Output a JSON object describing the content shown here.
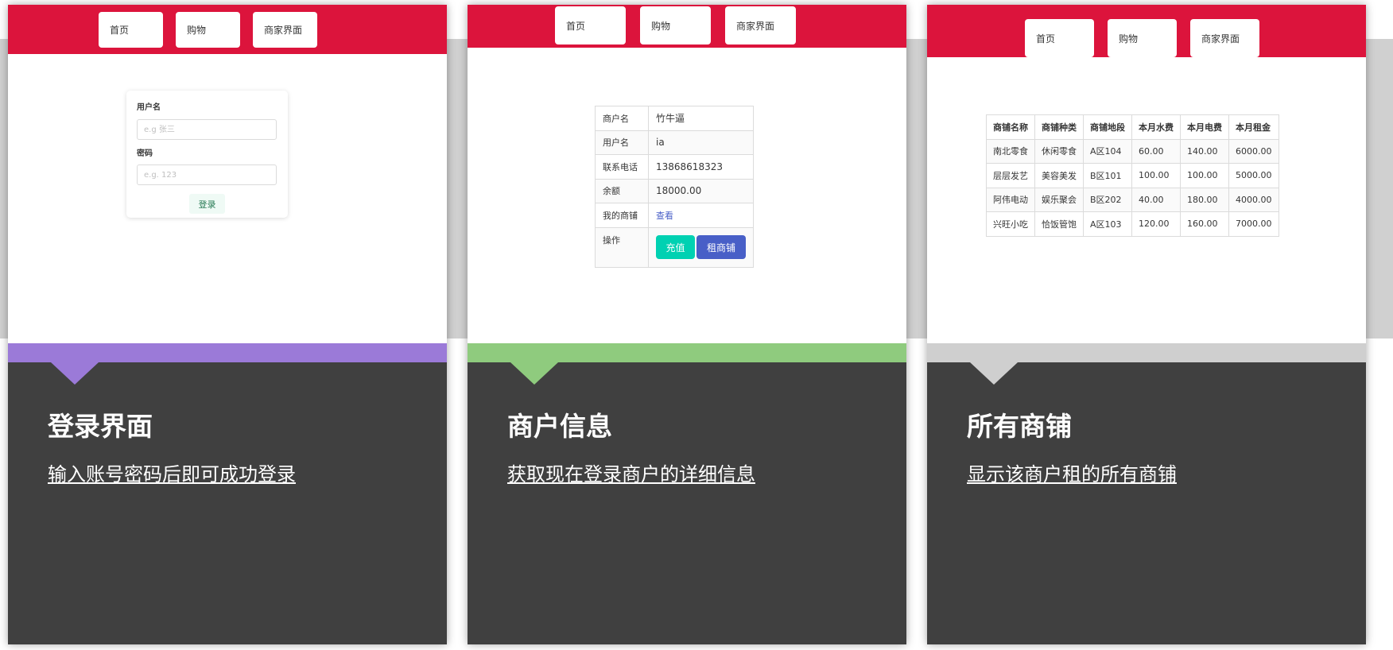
{
  "nav": {
    "home": "首页",
    "shop": "购物",
    "merchant": "商家界面"
  },
  "cards": [
    {
      "title": "登录界面",
      "desc": "输入账号密码后即可成功登录",
      "accent": "#9b7ad8"
    },
    {
      "title": "商户信息",
      "desc": "获取现在登录商户的详细信息",
      "accent": "#8fcb7e"
    },
    {
      "title": "所有商铺",
      "desc": "显示该商户租的所有商铺",
      "accent": "#cfcfcf"
    }
  ],
  "login": {
    "username_label": "用户名",
    "username_placeholder": "e.g 张三",
    "password_label": "密码",
    "password_placeholder": "e.g. 123",
    "submit": "登录"
  },
  "info": {
    "rows": [
      {
        "key": "商户名",
        "value": "竹牛逼"
      },
      {
        "key": "用户名",
        "value": "ia"
      },
      {
        "key": "联系电话",
        "value": "13868618323"
      },
      {
        "key": "余额",
        "value": "18000.00"
      },
      {
        "key": "我的商铺",
        "value": "查看"
      }
    ],
    "ops_label": "操作",
    "recharge": "充值",
    "rent": "租商铺"
  },
  "shops": {
    "headers": [
      "商铺名称",
      "商铺种类",
      "商铺地段",
      "本月水费",
      "本月电费",
      "本月租金"
    ],
    "rows": [
      [
        "南北零食",
        "休闲零食",
        "A区104",
        "60.00",
        "140.00",
        "6000.00"
      ],
      [
        "层层发艺",
        "美容美发",
        "B区101",
        "100.00",
        "100.00",
        "5000.00"
      ],
      [
        "阿伟电动",
        "娱乐聚会",
        "B区202",
        "40.00",
        "180.00",
        "4000.00"
      ],
      [
        "兴旺小吃",
        "恰饭管饱",
        "A区103",
        "120.00",
        "160.00",
        "7000.00"
      ]
    ]
  }
}
